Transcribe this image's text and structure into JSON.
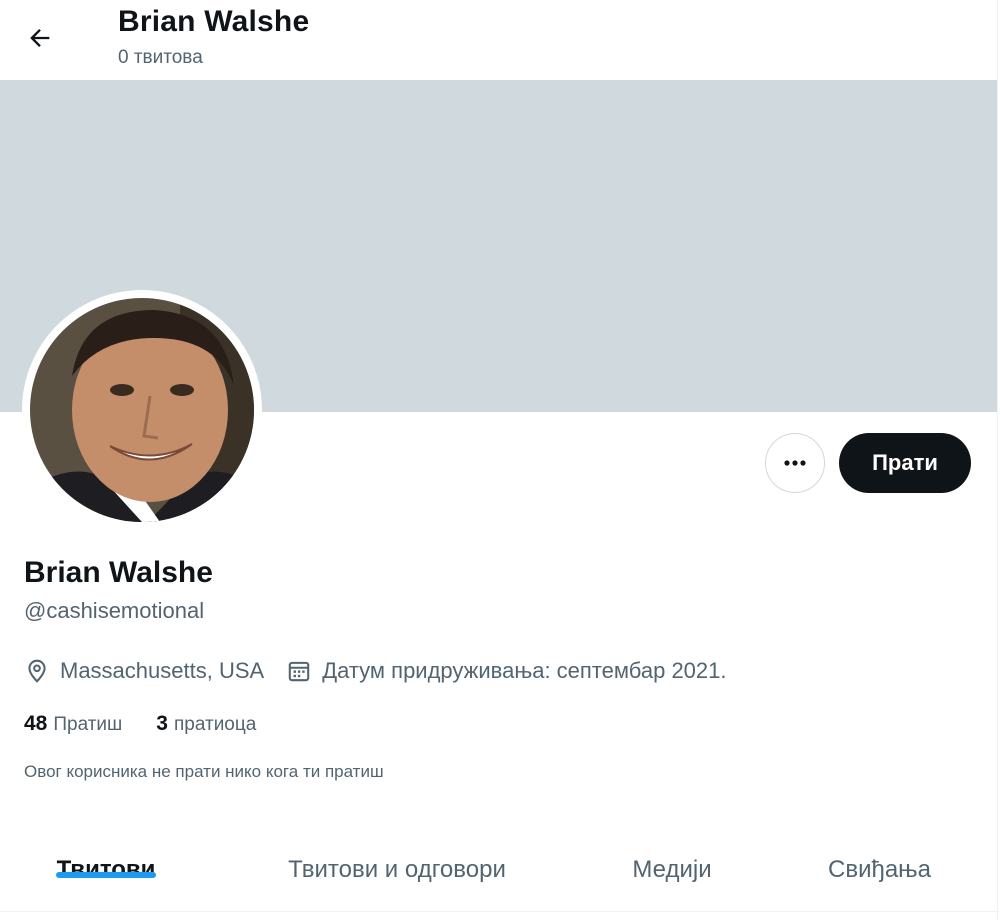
{
  "header": {
    "title": "Brian Walshe",
    "subtitle": "0 твитова",
    "back_icon": "arrow-left-icon"
  },
  "colors": {
    "banner": "#cfd9de",
    "text_primary": "#0f1419",
    "text_secondary": "#536471",
    "accent": "#1d9bf0",
    "follow_button_bg": "#0f1419"
  },
  "actions": {
    "more_icon": "more-horizontal-icon",
    "follow_label": "Прати"
  },
  "profile": {
    "name": "Brian Walshe",
    "handle": "@cashisemotional",
    "location": "Massachusetts, USA",
    "location_icon": "location-pin-icon",
    "joined": "Датум придруживања: септембар 2021.",
    "joined_icon": "calendar-icon",
    "following_count": "48",
    "following_label": "Пратиш",
    "followers_count": "3",
    "followers_label": "пратиоца",
    "followers_note": "Овог корисника не прати нико кога ти пратиш"
  },
  "tabs": [
    {
      "label": "Твитови",
      "active": true
    },
    {
      "label": "Твитови и одговори",
      "active": false
    },
    {
      "label": "Медији",
      "active": false
    },
    {
      "label": "Свиђања",
      "active": false
    }
  ]
}
